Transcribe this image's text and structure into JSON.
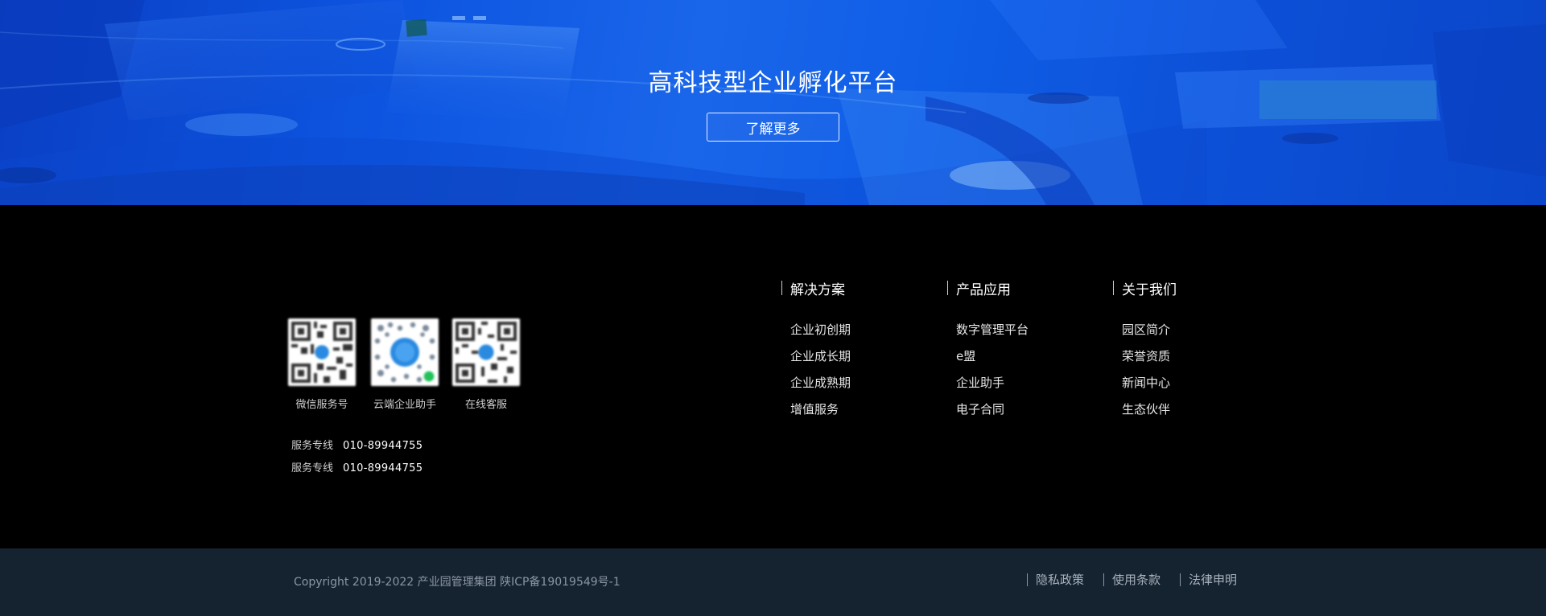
{
  "hero": {
    "title": "高科技型企业孵化平台",
    "button_label": "了解更多"
  },
  "qr_codes": [
    {
      "caption": "微信服务号",
      "icon": "qr-code-icon"
    },
    {
      "caption": "云端企业助手",
      "icon": "qr-code-icon"
    },
    {
      "caption": "在线客服",
      "icon": "qr-code-icon"
    }
  ],
  "hotlines": [
    {
      "label": "服务专线",
      "number": "010-89944755"
    },
    {
      "label": "服务专线",
      "number": "010-89944755"
    }
  ],
  "columns": [
    {
      "title": "解决方案",
      "links": [
        "企业初创期",
        "企业成长期",
        "企业成熟期",
        "增值服务"
      ]
    },
    {
      "title": "产品应用",
      "links": [
        "数字管理平台",
        "e盟",
        "企业助手",
        "电子合同"
      ]
    },
    {
      "title": "关于我们",
      "links": [
        "园区简介",
        "荣誉资质",
        "新闻中心",
        "生态伙伴"
      ]
    }
  ],
  "footer": {
    "copyright": "Copyright 2019-2022 产业园管理集团 陕ICP备19019549号-1",
    "legal_links": [
      "隐私政策",
      "使用条款",
      "法律申明"
    ]
  },
  "colors": {
    "hero_blue": "#0d55e0",
    "footer_bg": "#000000",
    "bottom_bar_bg": "#15222f"
  }
}
